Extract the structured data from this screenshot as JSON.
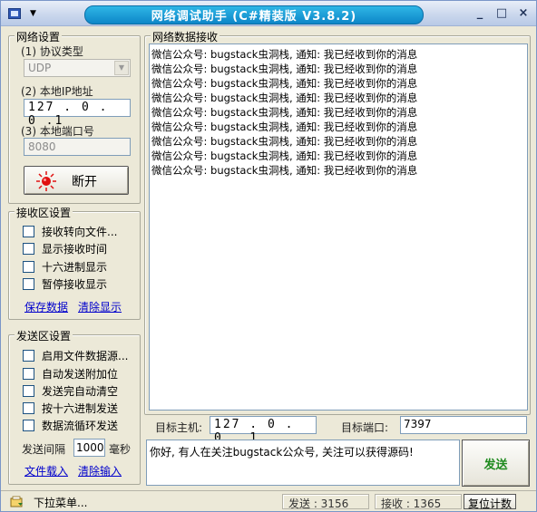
{
  "window": {
    "title": "网络调试助手 (C#精装版 V3.8.2)",
    "controls": [
      "_",
      "□",
      "×"
    ]
  },
  "network": {
    "group_title": "网络设置",
    "protocol_label": "(1) 协议类型",
    "protocol_value": "UDP",
    "ip_label": "(2) 本地IP地址",
    "ip_value": "127 . 0 . 0 .1",
    "port_label": "(3) 本地端口号",
    "port_value": "8080",
    "disconnect_label": "断开"
  },
  "receive_settings": {
    "group_title": "接收区设置",
    "options": [
      {
        "label": "接收转向文件...",
        "checked": false
      },
      {
        "label": "显示接收时间",
        "checked": false
      },
      {
        "label": "十六进制显示",
        "checked": false
      },
      {
        "label": "暂停接收显示",
        "checked": false
      }
    ],
    "save_link": "保存数据",
    "clear_link": "清除显示"
  },
  "send_settings": {
    "group_title": "发送区设置",
    "options": [
      {
        "label": "启用文件数据源...",
        "checked": false
      },
      {
        "label": "自动发送附加位",
        "checked": false
      },
      {
        "label": "发送完自动清空",
        "checked": false
      },
      {
        "label": "按十六进制发送",
        "checked": false
      },
      {
        "label": "数据流循环发送",
        "checked": false
      }
    ],
    "interval_label": "发送间隔",
    "interval_value": "1000",
    "interval_unit": "毫秒",
    "load_file_link": "文件载入",
    "clear_input_link": "清除输入"
  },
  "receive_area": {
    "group_title": "网络数据接收",
    "lines": [
      "微信公众号: bugstack虫洞栈, 通知: 我已经收到你的消息",
      "微信公众号: bugstack虫洞栈, 通知: 我已经收到你的消息",
      "微信公众号: bugstack虫洞栈, 通知: 我已经收到你的消息",
      "微信公众号: bugstack虫洞栈, 通知: 我已经收到你的消息",
      "微信公众号: bugstack虫洞栈, 通知: 我已经收到你的消息",
      "微信公众号: bugstack虫洞栈, 通知: 我已经收到你的消息",
      "微信公众号: bugstack虫洞栈, 通知: 我已经收到你的消息",
      "微信公众号: bugstack虫洞栈, 通知: 我已经收到你的消息",
      "微信公众号: bugstack虫洞栈, 通知: 我已经收到你的消息"
    ]
  },
  "target": {
    "host_label": "目标主机:",
    "host_value": "127 . 0 . 0 . 1",
    "port_label": "目标端口:",
    "port_value": "7397"
  },
  "send_area": {
    "text": "你好, 有人在关注bugstack公众号, 关注可以获得源码!",
    "send_button": "发送"
  },
  "status": {
    "menu_label": "下拉菜单...",
    "sent_label": "发送 : 3156",
    "recv_label": "接收 : 1365",
    "reset_button": "复位计数"
  },
  "colors": {
    "title_pill": "#0d86c8",
    "send_button_text": "#1e8a1e",
    "link": "#0000cc",
    "disconnect_icon": "#e01010"
  }
}
